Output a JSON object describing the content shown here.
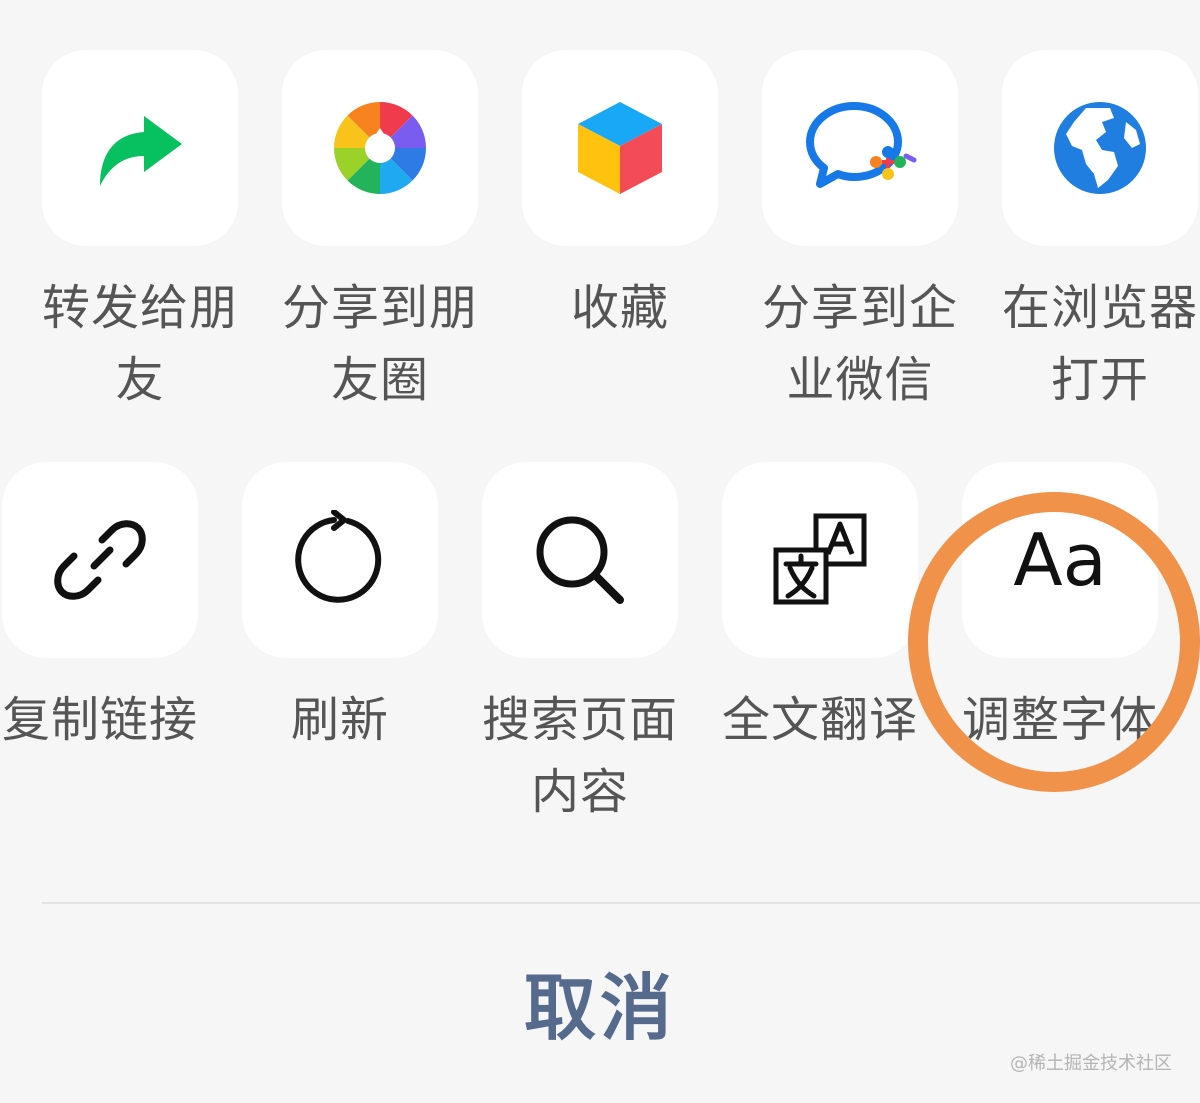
{
  "actions_row_1": [
    {
      "id": "share-friend",
      "label": "转发给朋友",
      "icon": "forward-arrow-icon"
    },
    {
      "id": "share-moments",
      "label": "分享到朋友圈",
      "icon": "moments-aperture-icon"
    },
    {
      "id": "favorite",
      "label": "收藏",
      "icon": "favorites-cube-icon"
    },
    {
      "id": "share-wework",
      "label": "分享到企业微信",
      "icon": "wework-chat-icon"
    },
    {
      "id": "open-browser",
      "label": "在浏览器打开",
      "icon": "globe-icon"
    }
  ],
  "actions_row_2": [
    {
      "id": "copy-link",
      "label": "复制链接",
      "icon": "link-icon"
    },
    {
      "id": "refresh",
      "label": "刷新",
      "icon": "refresh-icon"
    },
    {
      "id": "search-page",
      "label": "搜索页面内容",
      "icon": "search-icon"
    },
    {
      "id": "translate",
      "label": "全文翻译",
      "icon": "translate-icon"
    },
    {
      "id": "adjust-font",
      "label": "调整字体",
      "icon": "font-size-icon",
      "glyph": "Aa"
    }
  ],
  "cancel_label": "取消",
  "watermark": "@稀土掘金技术社区",
  "colors": {
    "background": "#f6f6f6",
    "tile": "#ffffff",
    "label": "#555555",
    "cancel": "#566a8e",
    "highlight_ring": "#f0924a",
    "forward_green": "#07c160",
    "globe_blue": "#1f7ee0"
  }
}
